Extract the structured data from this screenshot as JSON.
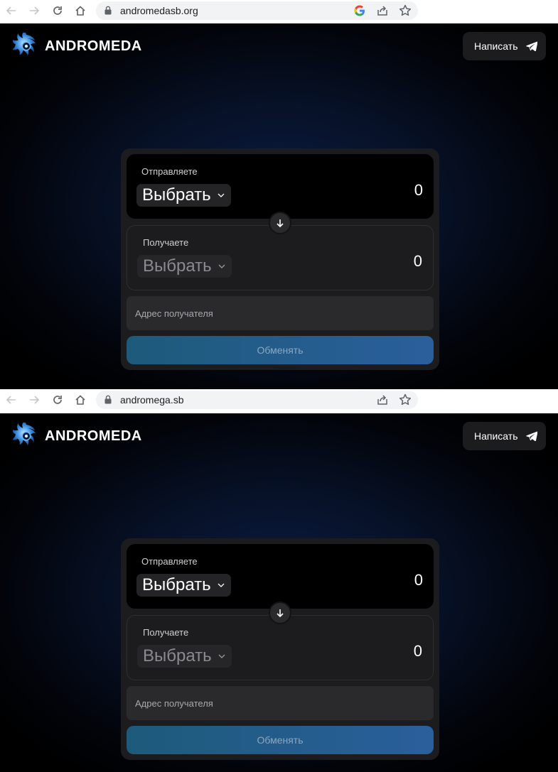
{
  "screenshots": [
    {
      "browser": {
        "url": "andromedasb.org",
        "show_google_icon": true
      },
      "header": {
        "brand": "ANDROMEDA",
        "write_button_label": "Написать"
      },
      "swap": {
        "send": {
          "label": "Отправляете",
          "select_label": "Выбрать",
          "amount": "0"
        },
        "receive": {
          "label": "Получаете",
          "select_label": "Выбрать",
          "amount": "0"
        },
        "address_placeholder": "Адрес получателя",
        "exchange_label": "Обменять"
      }
    },
    {
      "browser": {
        "url": "andromega.sb",
        "show_google_icon": false
      },
      "header": {
        "brand": "ANDROMEDA",
        "write_button_label": "Написать"
      },
      "swap": {
        "send": {
          "label": "Отправляете",
          "select_label": "Выбрать",
          "amount": "0"
        },
        "receive": {
          "label": "Получаете",
          "select_label": "Выбрать",
          "amount": "0"
        },
        "address_placeholder": "Адрес получателя",
        "exchange_label": "Обменять"
      }
    }
  ],
  "icons": {
    "back": "arrow-left-icon",
    "forward": "arrow-right-icon",
    "reload": "reload-icon",
    "home": "home-icon",
    "lock": "lock-icon",
    "google": "google-icon",
    "share": "share-icon",
    "bookmark": "star-icon",
    "logo": "galaxy-logo-icon",
    "telegram": "telegram-icon",
    "chevron": "chevron-down-icon",
    "swap_arrow": "arrow-down-icon"
  },
  "colors": {
    "page_bg": "#000000",
    "glow": "#0b1d45",
    "card_bg": "#1c1c1e",
    "button_gradient_start": "#1d5a7a",
    "button_gradient_end": "#2a5f9c"
  }
}
